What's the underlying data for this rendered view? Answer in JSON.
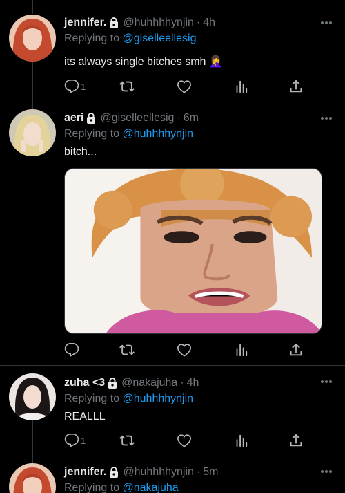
{
  "tweets": [
    {
      "name": "jennifer.",
      "handle": "@huhhhhynjin",
      "time": "4h",
      "replying_label": "Replying to",
      "replying_to": "@giselleellesig",
      "text": "its always single bitches smh 🤦‍♀️",
      "reply_count": "1"
    },
    {
      "name": "aeri",
      "handle": "@giselleellesig",
      "time": "6m",
      "replying_label": "Replying to",
      "replying_to": "@huhhhhynjin",
      "text": "bitch...",
      "reply_count": ""
    },
    {
      "name": "zuha <3",
      "handle": "@nakajuha",
      "time": "4h",
      "replying_label": "Replying to",
      "replying_to": "@huhhhhynjin",
      "text": "REALLL",
      "reply_count": "1"
    },
    {
      "name": "jennifer.",
      "handle": "@huhhhhynjin",
      "time": "5m",
      "replying_label": "Replying to",
      "replying_to": "@nakajuha",
      "text": "",
      "reply_count": ""
    }
  ],
  "separator": "·",
  "icons": [
    "reply-icon",
    "retweet-icon",
    "like-icon",
    "analytics-icon",
    "share-icon",
    "lock-icon",
    "more-icon"
  ],
  "colors": {
    "background": "#000000",
    "text": "#e7e9ea",
    "muted": "#71767b",
    "link": "#1d9bf0",
    "divider": "#2f3336"
  }
}
